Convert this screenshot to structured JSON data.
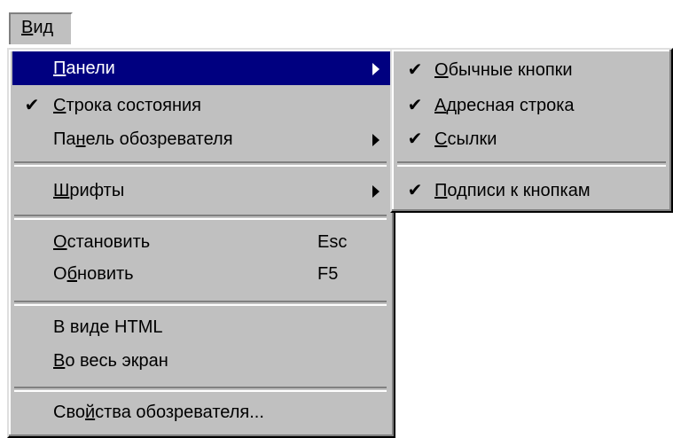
{
  "menubar": {
    "view_label_accel": "В",
    "view_label_rest": "ид"
  },
  "main_menu": {
    "items": [
      {
        "accel_pre": "",
        "accel": "П",
        "rest": "анели",
        "shortcut": "",
        "checked": false,
        "submenu": true,
        "selected": true
      },
      {
        "accel_pre": "",
        "accel": "С",
        "rest": "трока состояния",
        "shortcut": "",
        "checked": true,
        "submenu": false,
        "selected": false
      },
      {
        "accel_pre": "Па",
        "accel": "н",
        "rest": "ель обозревателя",
        "shortcut": "",
        "checked": false,
        "submenu": true,
        "selected": false
      },
      {
        "accel_pre": "",
        "accel": "Ш",
        "rest": "рифты",
        "shortcut": "",
        "checked": false,
        "submenu": true,
        "selected": false
      },
      {
        "accel_pre": "",
        "accel": "О",
        "rest": "становить",
        "shortcut": "Esc",
        "checked": false,
        "submenu": false,
        "selected": false
      },
      {
        "accel_pre": "О",
        "accel": "б",
        "rest": "новить",
        "shortcut": "F5",
        "checked": false,
        "submenu": false,
        "selected": false
      },
      {
        "accel_pre": "В ви",
        "accel": "д",
        "rest": "е HTML",
        "shortcut": "",
        "checked": false,
        "submenu": false,
        "selected": false
      },
      {
        "accel_pre": "",
        "accel": "В",
        "rest": "о весь экран",
        "shortcut": "",
        "checked": false,
        "submenu": false,
        "selected": false
      },
      {
        "accel_pre": "Сво",
        "accel": "й",
        "rest": "ства обозревателя...",
        "shortcut": "",
        "checked": false,
        "submenu": false,
        "selected": false
      }
    ]
  },
  "sub_menu": {
    "items": [
      {
        "accel_pre": "",
        "accel": "О",
        "rest": "бычные кнопки",
        "checked": true
      },
      {
        "accel_pre": "",
        "accel": "А",
        "rest": "дресная строка",
        "checked": true
      },
      {
        "accel_pre": "",
        "accel": "С",
        "rest": "сылки",
        "checked": true
      },
      {
        "accel_pre": "",
        "accel": "П",
        "rest": "одписи к кнопкам",
        "checked": true
      }
    ]
  },
  "check_glyph": "✔",
  "colors": {
    "menu_face": "#c0c0c0",
    "highlight": "#000080",
    "highlight_text": "#ffffff"
  }
}
